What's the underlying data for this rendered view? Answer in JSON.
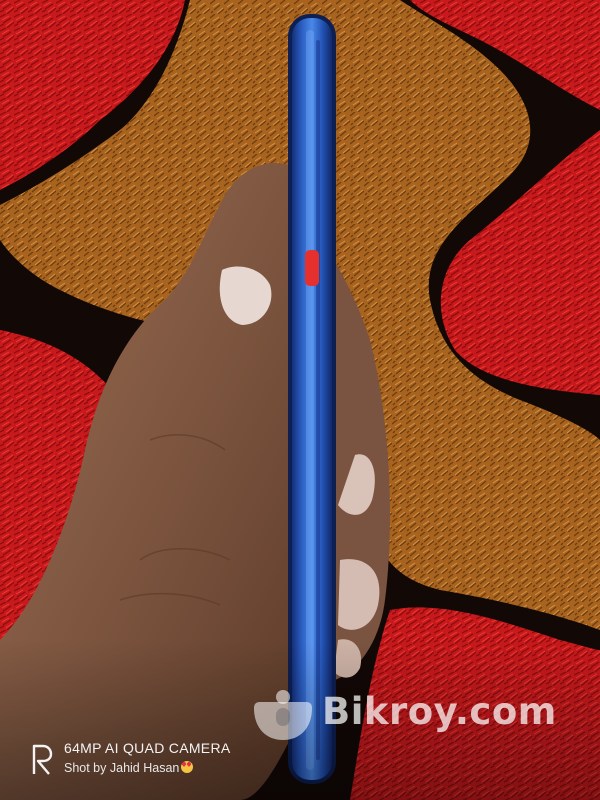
{
  "photo": {
    "subject": "Hand holding a blue smartphone showing its side edge with a red power button, on a red, black and orange shag rug"
  },
  "colors": {
    "rug_red": "#c8191c",
    "rug_orange": "#a8641f",
    "rug_black": "#120806",
    "phone_blue": "#2f66c9",
    "power_button": "#e6302e",
    "skin": "#8a6048"
  },
  "watermark": {
    "text": "Bikroy.com"
  },
  "camera_stamp": {
    "line1": "64MP AI QUAD CAMERA",
    "line2": "Shot by Jahid Hasan"
  }
}
